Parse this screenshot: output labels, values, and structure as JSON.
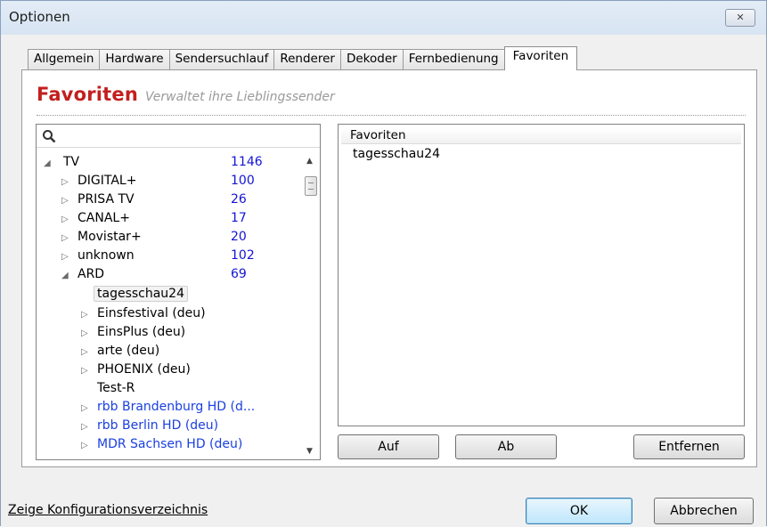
{
  "window": {
    "title": "Optionen",
    "close_label": "✕"
  },
  "tabs": [
    {
      "label": "Allgemein"
    },
    {
      "label": "Hardware"
    },
    {
      "label": "Sendersuchlauf"
    },
    {
      "label": "Renderer"
    },
    {
      "label": "Dekoder"
    },
    {
      "label": "Fernbedienung"
    },
    {
      "label": "Favoriten",
      "active": true
    }
  ],
  "heading": {
    "title": "Favoriten",
    "subtitle": "Verwaltet ihre Lieblingssender"
  },
  "tree": {
    "search_placeholder": "",
    "items": [
      {
        "label": "TV",
        "count": "1146",
        "expanded": true
      },
      {
        "label": "DIGITAL+",
        "count": "100"
      },
      {
        "label": "PRISA TV",
        "count": "26"
      },
      {
        "label": "CANAL+",
        "count": "17"
      },
      {
        "label": "Movistar+",
        "count": "20"
      },
      {
        "label": "unknown",
        "count": "102"
      },
      {
        "label": "ARD",
        "count": "69",
        "expanded": true
      },
      {
        "label": "tagesschau24",
        "selected": true
      },
      {
        "label": "Einsfestival (deu)"
      },
      {
        "label": "EinsPlus (deu)"
      },
      {
        "label": "arte (deu)"
      },
      {
        "label": "PHOENIX (deu)"
      },
      {
        "label": "Test-R"
      },
      {
        "label": "rbb Brandenburg HD (d..."
      },
      {
        "label": "rbb Berlin HD (deu)"
      },
      {
        "label": "MDR Sachsen HD (deu)"
      }
    ]
  },
  "favorites": {
    "header": "Favoriten",
    "items": [
      "tagesschau24"
    ]
  },
  "buttons": {
    "up": "Auf",
    "down": "Ab",
    "remove": "Entfernen",
    "ok": "OK",
    "cancel": "Abbrechen"
  },
  "footer": {
    "config_link": "Zeige Konfigurationsverzeichnis"
  },
  "colors": {
    "heading": "#c31f1f",
    "count": "#1414d6",
    "link_channel": "#1a3fe0"
  }
}
